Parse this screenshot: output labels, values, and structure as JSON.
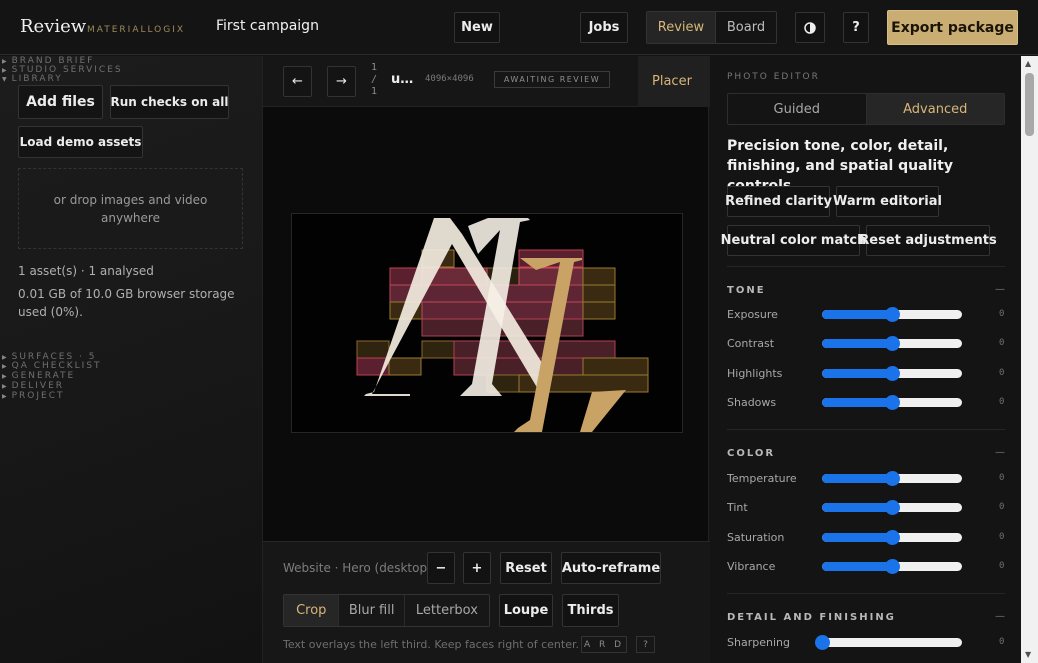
{
  "header": {
    "logo": "Review",
    "brand": "MATERIALLOGIX",
    "campaign": "First campaign",
    "new_label": "New",
    "jobs_label": "Jobs",
    "view_tabs": [
      "Review",
      "Board"
    ],
    "contrast_icon": "contrast-icon",
    "help_label": "?",
    "export_label": "Export package",
    "accent": "#c9ad73"
  },
  "sidebar": {
    "brand_brief": "BRAND BRIEF",
    "studio_services": "STUDIO SERVICES",
    "library": "LIBRARY",
    "add_files": "Add files",
    "run_checks": "Run checks on all",
    "load_demo": "Load demo assets",
    "drop_text": "or drop images and video anywhere",
    "asset_count": "1 asset(s) · 1 analysed",
    "storage": "0.01 GB of 10.0 GB browser storage used (0%).",
    "surfaces": "SURFACES · 5",
    "qa_checklist": "QA CHECKLIST",
    "generate": "GENERATE",
    "deliver": "DELIVER",
    "project": "PROJECT"
  },
  "viewer": {
    "prev_icon": "←",
    "next_icon": "→",
    "page_current": "1",
    "page_sep": "/",
    "page_total": "1",
    "filename": "u…",
    "dimensions": "4096×4096",
    "status": "AWAITING REVIEW",
    "placer_label": "Placer"
  },
  "bottom": {
    "surface": "Website · Hero (desktop)",
    "zoom_out": "−",
    "zoom_in": "+",
    "reset": "Reset",
    "auto_reframe": "Auto-reframe",
    "modes": [
      "Crop",
      "Blur fill",
      "Letterbox"
    ],
    "loupe": "Loupe",
    "thirds": "Thirds",
    "hint": "Text overlays the left third. Keep faces right of center.",
    "ard": "A R D",
    "help": "?"
  },
  "editor": {
    "title": "PHOTO EDITOR",
    "tabs": [
      "Guided",
      "Advanced"
    ],
    "description": "Precision tone, color, detail, finishing, and spatial quality controls.",
    "presets": [
      "Refined clarity",
      "Warm editorial",
      "Neutral color match",
      "Reset adjustments"
    ],
    "groups": [
      {
        "name": "TONE",
        "collapse": "—",
        "sliders": [
          {
            "label": "Exposure",
            "value": "0",
            "level": 0.5
          },
          {
            "label": "Contrast",
            "value": "0",
            "level": 0.5
          },
          {
            "label": "Highlights",
            "value": "0",
            "level": 0.5
          },
          {
            "label": "Shadows",
            "value": "0",
            "level": 0.5
          }
        ]
      },
      {
        "name": "COLOR",
        "collapse": "—",
        "sliders": [
          {
            "label": "Temperature",
            "value": "0",
            "level": 0.5
          },
          {
            "label": "Tint",
            "value": "0",
            "level": 0.5
          },
          {
            "label": "Saturation",
            "value": "0",
            "level": 0.5
          },
          {
            "label": "Vibrance",
            "value": "0",
            "level": 0.5
          }
        ]
      },
      {
        "name": "DETAIL AND FINISHING",
        "collapse": "—",
        "sliders": [
          {
            "label": "Sharpening",
            "value": "0",
            "level": 0.0
          }
        ]
      }
    ],
    "slider_color": "#1a73e8"
  }
}
